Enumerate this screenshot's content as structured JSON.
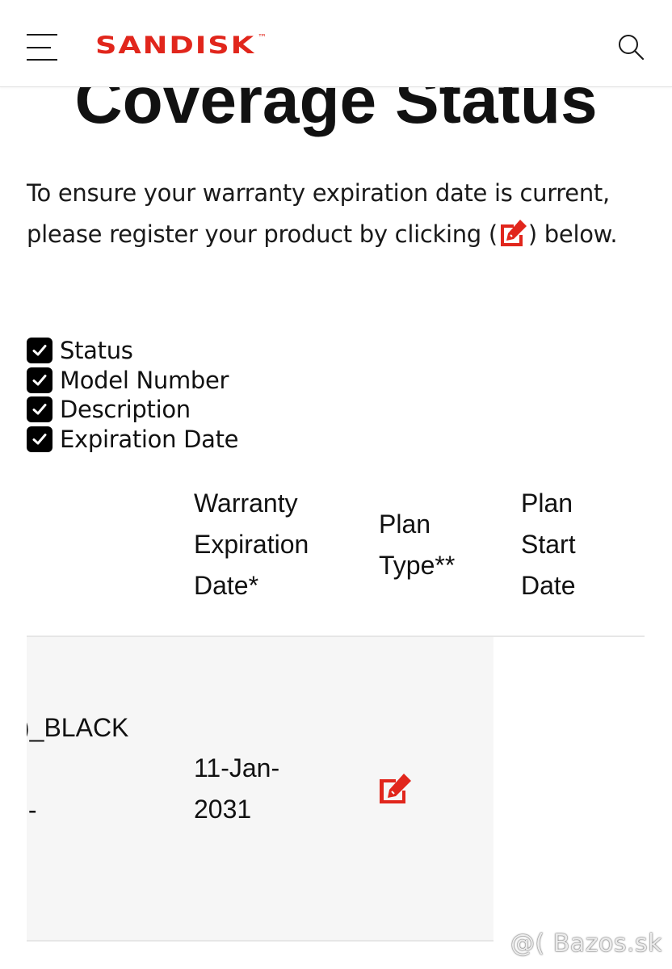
{
  "header": {
    "brand": "SANDISK",
    "trademark": "™",
    "menu_icon": "hamburger-menu-icon",
    "search_icon": "search-icon"
  },
  "page": {
    "title": "Coverage Status",
    "intro_line1": "To ensure your warranty expiration date is current,",
    "intro_line2_before": "please register your product by clicking (",
    "intro_line2_after": ") below.",
    "intro_icon": "edit-square-icon"
  },
  "checklist": [
    {
      "label": "Status",
      "checked": true
    },
    {
      "label": "Model Number",
      "checked": true
    },
    {
      "label": "Description",
      "checked": true
    },
    {
      "label": "Expiration Date",
      "checked": true
    }
  ],
  "table": {
    "headers": {
      "warranty_line1": "Warranty",
      "warranty_line2": "Expiration",
      "warranty_line3": "Date*",
      "plan_type_line1": "Plan",
      "plan_type_line2": "Type**",
      "plan_start_line1": "Plan",
      "plan_start_line2": "Start",
      "plan_start_line3": "Date"
    },
    "row": {
      "model_fragment": ")_BLACK",
      "description_fragment": "ı-",
      "expiry_line1": "11-Jan-",
      "expiry_line2": "2031",
      "register_icon": "edit-square-icon"
    }
  },
  "watermark": "@( Bazos.sk",
  "colors": {
    "brand_red": "#E1261C",
    "text": "#111111",
    "row_background": "#F6F6F6",
    "divider": "#E6E6E6"
  }
}
